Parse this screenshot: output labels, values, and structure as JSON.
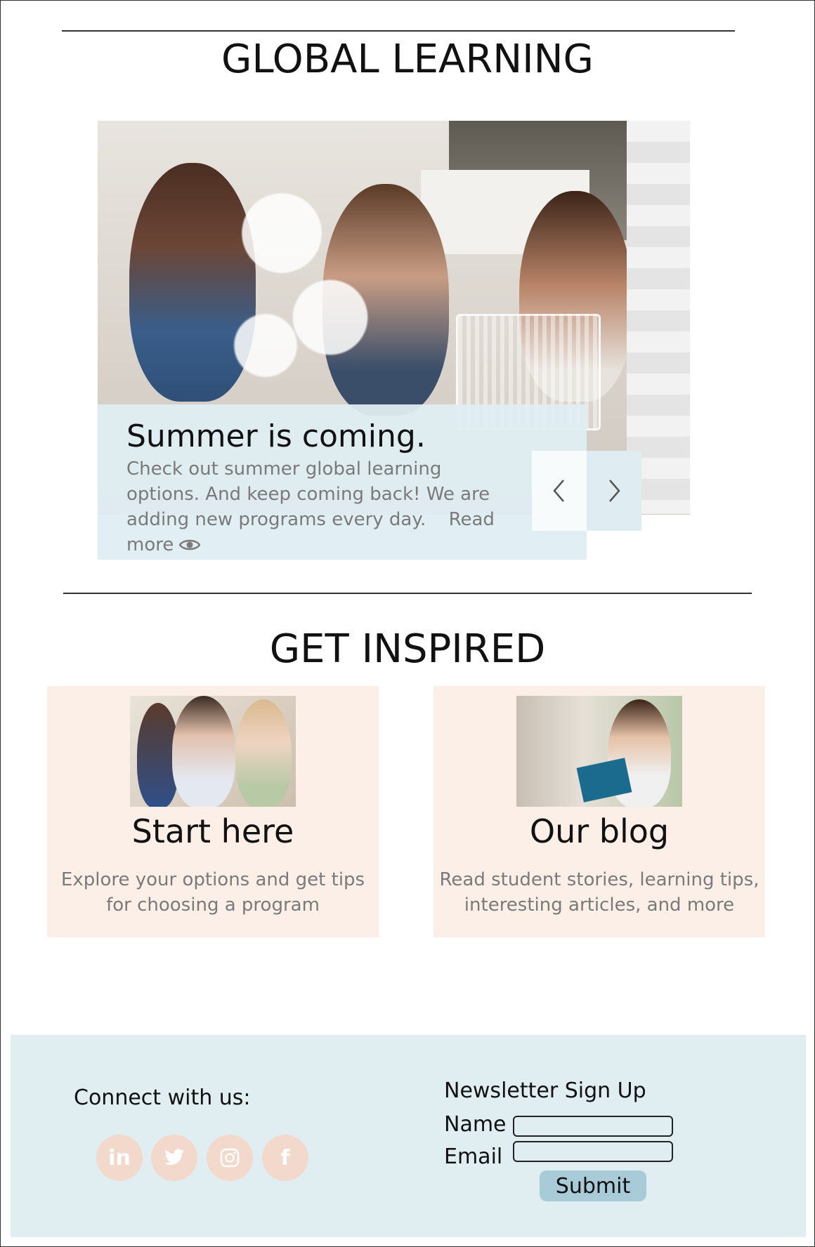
{
  "header": {
    "title": "GLOBAL LEARNING"
  },
  "hero": {
    "heading": "Summer is coming.",
    "text": "Check out summer global learning options. And keep coming back! We are adding new programs every day.",
    "read_more": "Read more",
    "prev_icon": "chevron-left-icon",
    "next_icon": "chevron-right-icon",
    "read_more_icon": "eye-icon"
  },
  "inspired": {
    "title": "GET INSPIRED",
    "cards": [
      {
        "title": "Start here",
        "desc_line1": "Explore your options and get tips",
        "desc_line2": "for choosing a program"
      },
      {
        "title": "Our blog",
        "desc_line1": "Read student stories, learning tips,",
        "desc_line2": "interesting articles, and more"
      }
    ]
  },
  "footer": {
    "connect_label": "Connect with us:",
    "social": [
      {
        "name": "linkedin-icon",
        "glyph": "in"
      },
      {
        "name": "twitter-icon",
        "glyph": ""
      },
      {
        "name": "instagram-icon",
        "glyph": ""
      },
      {
        "name": "facebook-icon",
        "glyph": "f"
      }
    ],
    "newsletter": {
      "title": "Newsletter Sign Up",
      "name_label": "Name",
      "email_label": "Email",
      "name_value": "",
      "email_value": "",
      "submit_label": "Submit"
    }
  },
  "colors": {
    "caption_bg": "#dfedf2",
    "card_bg": "#fbefe8",
    "footer_bg": "#e0eef2",
    "social_bg": "#f3d8cc",
    "submit_bg": "#a9cbd8",
    "muted_text": "#7a7a7a"
  }
}
